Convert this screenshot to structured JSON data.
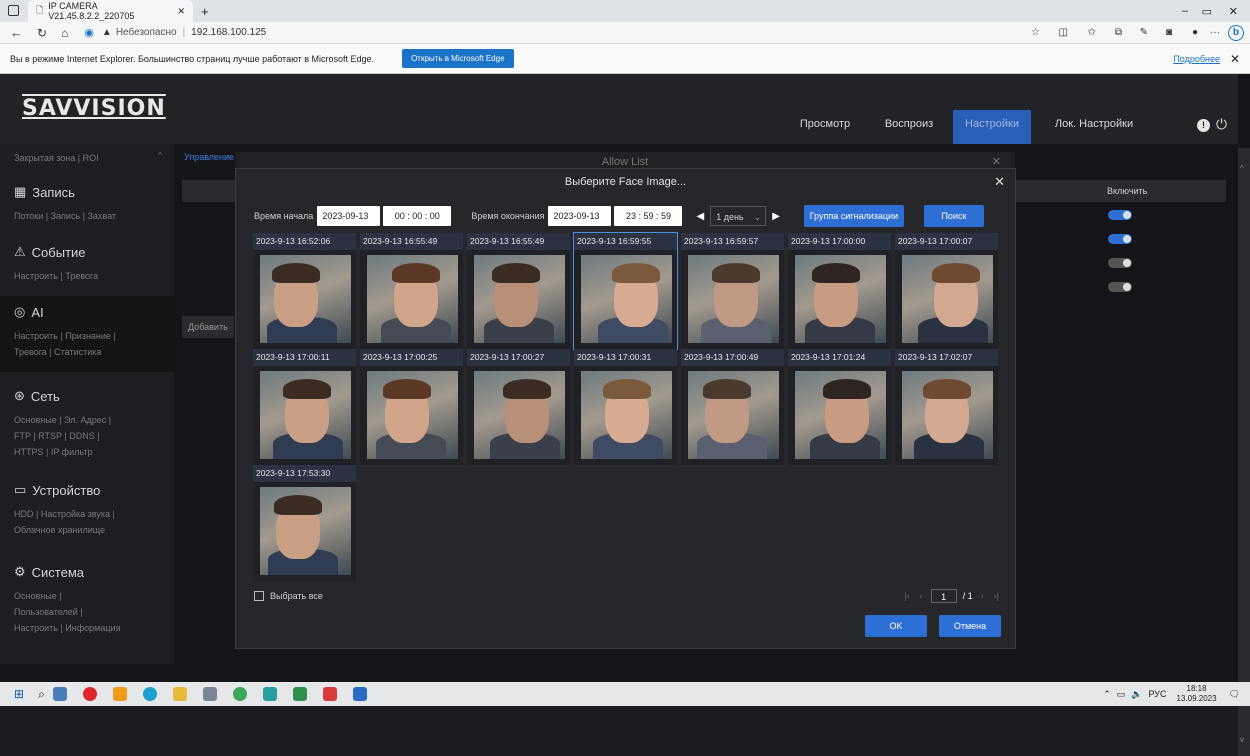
{
  "browser": {
    "tab_title": "IP CAMERA V21.45.8.2.2_220705",
    "url_warning": "Небезопасно",
    "url": "192.168.100.125",
    "ie_message": "Вы в режиме Internet Explorer. Большинство страниц лучше работают в Microsoft Edge.",
    "ie_button": "Открыть в Microsoft Edge",
    "ie_more": "Подробнее"
  },
  "app": {
    "logo": "SAVVISION",
    "nav": [
      "Просмотр",
      "Воспроиз",
      "Настройки",
      "Лок. Настройки"
    ],
    "sidebar": {
      "top": "Закрытая зона | ROI",
      "sections": [
        {
          "title": "Запись",
          "sub": "Потоки | Запись | Захват"
        },
        {
          "title": "Событие",
          "sub": "Настроить | Тревога"
        },
        {
          "title": "AI",
          "sub": "Настроить | Признание |",
          "sub2": "Тревога | Статистика"
        },
        {
          "title": "Сеть",
          "sub": "Основные | Эл. Адрес |",
          "sub2": "FTP | RTSP | DDNS |",
          "sub3": "HTTPS | IP фильтр"
        },
        {
          "title": "Устройство",
          "sub": "HDD | Настройка звука |",
          "sub2": "Облачное хранилище"
        },
        {
          "title": "Система",
          "sub": "Основные |",
          "sub2": "Пользователей |",
          "sub3": "Настроить | Информация"
        }
      ]
    },
    "main": {
      "breadcrumb": "Управление",
      "add_button": "Добавить",
      "enable_header": "Включить",
      "toggles": [
        true,
        true,
        false,
        false
      ]
    }
  },
  "allow_dialog": {
    "title": "Allow List"
  },
  "modal": {
    "title": "Выберите Face Image...",
    "start_label": "Время начала",
    "start_date": "2023-09-13",
    "start_time": "00 : 00 : 00",
    "end_label": "Время окончания",
    "end_date": "2023-09-13",
    "end_time": "23 : 59 : 59",
    "period": "1 день",
    "alarm_group_button": "Группа сигнализации",
    "search_button": "Поиск",
    "images": [
      "2023-9-13 16:52:06",
      "2023-9-13 16:55:49",
      "2023-9-13 16:55:49",
      "2023-9-13 16:59:55",
      "2023-9-13 16:59:57",
      "2023-9-13 17:00:00",
      "2023-9-13 17:00:07",
      "2023-9-13 17:00:11",
      "2023-9-13 17:00:25",
      "2023-9-13 17:00:27",
      "2023-9-13 17:00:31",
      "2023-9-13 17:00:49",
      "2023-9-13 17:01:24",
      "2023-9-13 17:02:07",
      "2023-9-13 17:53:30"
    ],
    "selected_index": 3,
    "select_all": "Выбрать все",
    "page_current": "1",
    "page_total": "/ 1",
    "ok_button": "OK",
    "cancel_button": "Отмена"
  },
  "taskbar": {
    "lang": "РУС",
    "time": "18:18",
    "date": "13.09.2023"
  },
  "colors": {
    "accent": "#2e6fd6",
    "active_nav": "#2a5fb8",
    "caption_bg": "#2c3242"
  }
}
